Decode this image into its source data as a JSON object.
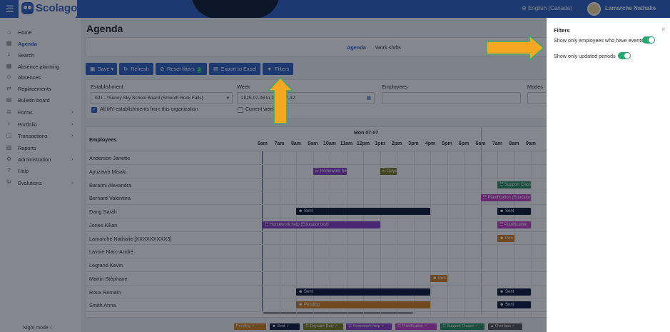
{
  "header": {
    "brand": "Scolago",
    "language": "English (Canada)",
    "user": "Lamarche Nathalie"
  },
  "sidebar": {
    "items": [
      {
        "label": "Home",
        "icon": "home-icon",
        "glyph": "⌂"
      },
      {
        "label": "Agenda",
        "icon": "calendar-icon",
        "glyph": "▦",
        "active": true
      },
      {
        "label": "Search",
        "icon": "search-icon",
        "glyph": "⌕"
      },
      {
        "label": "Absence planning",
        "icon": "calendar-icon",
        "glyph": "▦"
      },
      {
        "label": "Absences",
        "icon": "user-icon",
        "glyph": "☺"
      },
      {
        "label": "Replacements",
        "icon": "swap-icon",
        "glyph": "⇄"
      },
      {
        "label": "Bulletin board",
        "icon": "board-icon",
        "glyph": "▤"
      },
      {
        "label": "Forms",
        "icon": "form-icon",
        "glyph": "≣",
        "chev": true
      },
      {
        "label": "Portfolio",
        "icon": "trophy-icon",
        "glyph": "♆",
        "chev": true
      },
      {
        "label": "Transactions",
        "icon": "transactions-icon",
        "glyph": "▢",
        "chev": true
      },
      {
        "label": "Reports",
        "icon": "report-icon",
        "glyph": "▥"
      },
      {
        "label": "Administration",
        "icon": "gear-icon",
        "glyph": "⚙",
        "chev": true
      },
      {
        "label": "Help",
        "icon": "help-icon",
        "glyph": "?"
      },
      {
        "label": "Evolutions",
        "icon": "evolution-icon",
        "glyph": "Ψ",
        "chev": true
      }
    ],
    "night_mode": "Night mode"
  },
  "page": {
    "title": "Agenda",
    "tabs": [
      "Agenda",
      "Work shifts"
    ]
  },
  "toolbar": {
    "save": "Save",
    "refresh": "Refresh",
    "reset": "Reset filters",
    "reset_count": "2",
    "export": "Export to Excel",
    "filters": "Filters"
  },
  "form": {
    "establishment_label": "Establishment",
    "establishment_value": "001 - *Sunny Sky School Board (Smooth Rock Falls)",
    "all_my_label": "All MY establishments from this organization",
    "week_label": "Week",
    "week_value": "2025-07-06 to 2025-07-12",
    "current_week": "Current week",
    "employees_label": "Employees",
    "modes_label": "Modes"
  },
  "grid": {
    "employees_header": "Employees",
    "day": "Mon 07-07",
    "hours": [
      "6am",
      "7am",
      "8am",
      "9am",
      "10am",
      "11am",
      "12pm",
      "1pm",
      "2pm",
      "3pm",
      "4pm",
      "5pm",
      "6pm",
      "6am",
      "7am",
      "8am",
      "9am"
    ],
    "employees": [
      "Anderson Janette",
      "Ayuzawa Misaki",
      "Baratini Alexandra",
      "Bernard Valentina",
      "Dang Sarah",
      "Jones Kilian",
      "Lamarche Nathalie [XXXXXXXXX3]",
      "Lavoie Marc-André",
      "Legrand Kevin",
      "Martin Stéphane",
      "Roux Romain",
      "Smith Anna"
    ],
    "events": [
      {
        "row": 1,
        "start": 9.0,
        "end": 11.0,
        "label": "☷ Homework help",
        "color": "#8e3fc4"
      },
      {
        "row": 1,
        "start": 13.0,
        "end": 14.0,
        "label": "☷ Daycare",
        "color": "#7d7a1e"
      },
      {
        "row": 2,
        "start": 20.0,
        "end": 22.0,
        "label": "☷ Support Class",
        "color": "#2b8c5c"
      },
      {
        "row": 3,
        "start": 19.0,
        "end": 22.0,
        "label": "☷ Planification (Educator)",
        "color": "#c63fc4"
      },
      {
        "row": 4,
        "start": 8.0,
        "end": 16.0,
        "label": "☻ Sent",
        "color": "#0f1a3a"
      },
      {
        "row": 4,
        "start": 20.0,
        "end": 22.0,
        "label": "☻ Sent",
        "color": "#0f1a3a"
      },
      {
        "row": 5,
        "start": 6.0,
        "end": 13.0,
        "label": "☷ Homework help (Educator test)",
        "color": "#8e3fc4"
      },
      {
        "row": 5,
        "start": 20.0,
        "end": 22.0,
        "label": "☷ Planification",
        "color": "#c63fc4"
      },
      {
        "row": 6,
        "start": 20.0,
        "end": 21.0,
        "label": "☻ Pen",
        "color": "#d9821f"
      },
      {
        "row": 9,
        "start": 16.0,
        "end": 17.0,
        "label": "☻ Pen",
        "color": "#d9821f"
      },
      {
        "row": 10,
        "start": 8.0,
        "end": 16.0,
        "label": "☻ Sent",
        "color": "#0f1a3a"
      },
      {
        "row": 10,
        "start": 20.0,
        "end": 22.0,
        "label": "☻ Sent",
        "color": "#0f1a3a"
      },
      {
        "row": 11,
        "start": 8.0,
        "end": 16.0,
        "label": "☻ Pending",
        "color": "#d9821f"
      },
      {
        "row": 11,
        "start": 20.0,
        "end": 22.0,
        "label": "☻ Sent",
        "color": "#0f1a3a"
      }
    ]
  },
  "legend": [
    {
      "label": "Pending ✓",
      "color": "#d9821f"
    },
    {
      "label": "☻ Sent ✓",
      "color": "#0f1a3a"
    },
    {
      "label": "☷ Daycare Duty ✓",
      "color": "#7d7a1e"
    },
    {
      "label": "☷ Homework help ✓",
      "color": "#8e3fc4"
    },
    {
      "label": "☷ Planification ✓",
      "color": "#c63fc4"
    },
    {
      "label": "☷ Support Classe ✓",
      "color": "#2b8c5c"
    },
    {
      "label": "▲ Overlaps ✓",
      "color": "#555555"
    }
  ],
  "filters_panel": {
    "title": "Filters",
    "close": "×",
    "opt1": "Show only employees who have events",
    "opt2": "Show only updated periods"
  }
}
